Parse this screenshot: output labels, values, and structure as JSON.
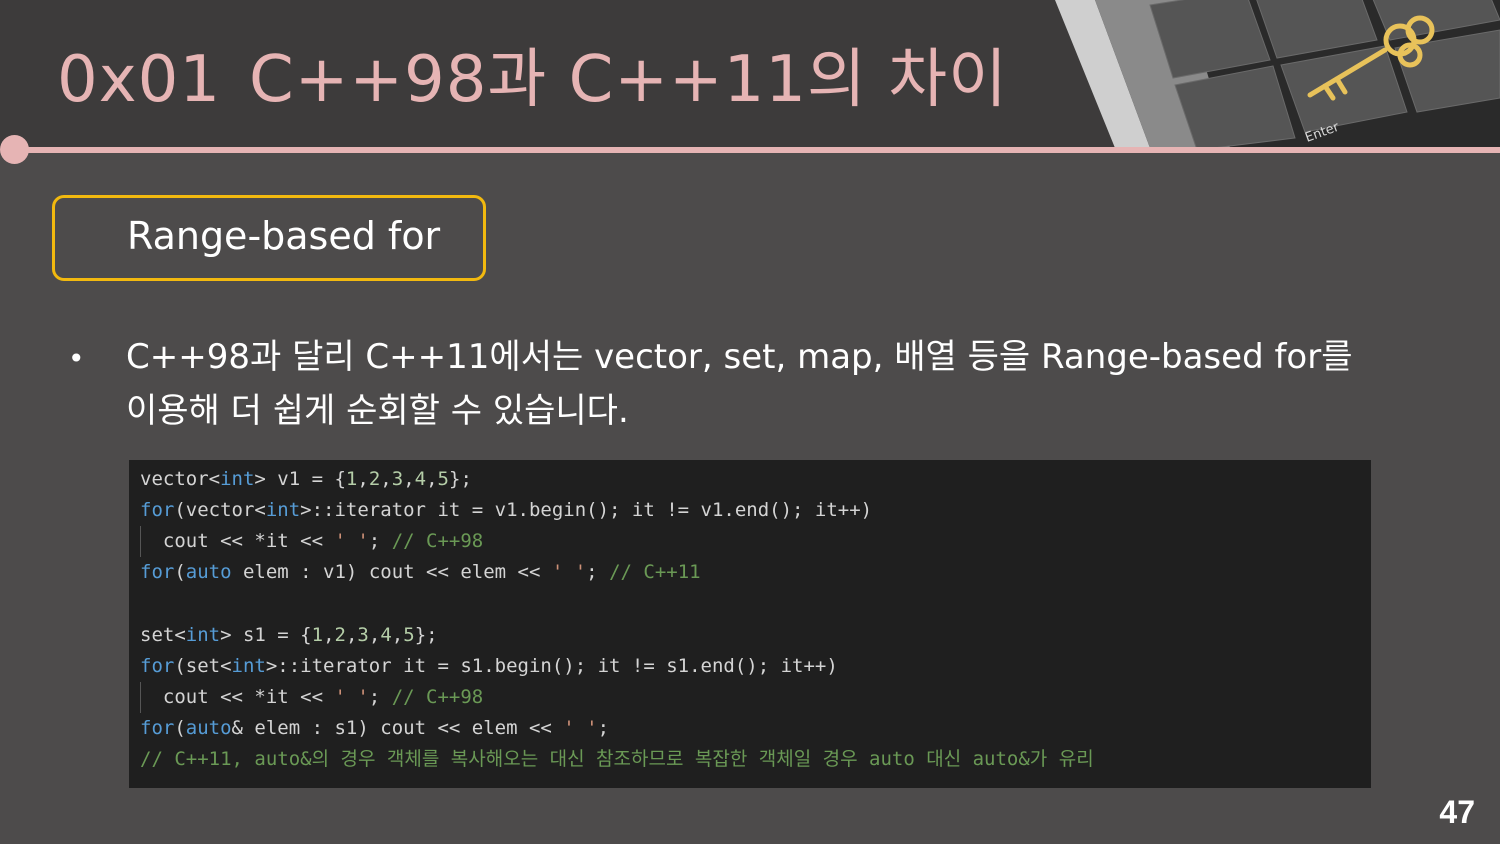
{
  "slide": {
    "title_number": "0x01",
    "title_text": "C++98과 C++11의 차이",
    "section_label": "Range-based for",
    "bullet_line1": "C++98과 달리 C++11에서는 vector, set, map, 배열 등을 Range-based for를",
    "bullet_line2": "이용해 더 쉽게 순회할 수 있습니다.",
    "page_number": "47",
    "header_image_key_label": "Enter",
    "accent_color": "#e6b4b4",
    "box_border_color": "#f2b90f"
  },
  "code": {
    "l1": {
      "a": "vector<",
      "b": "int",
      "c": "> v1 = {",
      "d": "1",
      "e": ",",
      "f": "2",
      "g": ",",
      "h": "3",
      "i": ",",
      "j": "4",
      "k": ",",
      "l": "5",
      "m": "};"
    },
    "l2": {
      "a": "for",
      "b": "(vector<",
      "c": "int",
      "d": ">::iterator it = v1.begin(); it != v1.end(); it++)"
    },
    "l3": {
      "a": "  cout << *it << ",
      "b": "' '",
      "c": "; ",
      "d": "// C++98"
    },
    "l4": {
      "a": "for",
      "b": "(",
      "c": "auto",
      "d": " elem : v1) cout << elem << ",
      "e": "' '",
      "f": "; ",
      "g": "// C++11"
    },
    "l6": {
      "a": "set<",
      "b": "int",
      "c": "> s1 = {",
      "d": "1",
      "e": ",",
      "f": "2",
      "g": ",",
      "h": "3",
      "i": ",",
      "j": "4",
      "k": ",",
      "l": "5",
      "m": "};"
    },
    "l7": {
      "a": "for",
      "b": "(set<",
      "c": "int",
      "d": ">::iterator it = s1.begin(); it != s1.end(); it++)"
    },
    "l8": {
      "a": "  cout << *it << ",
      "b": "' '",
      "c": "; ",
      "d": "// C++98"
    },
    "l9": {
      "a": "for",
      "b": "(",
      "c": "auto",
      "d": "& elem : s1) cout << elem << ",
      "e": "' '",
      "f": ";"
    },
    "l10": {
      "a": "// C++11, auto&의 경우 객체를 복사해오는 대신 참조하므로 복잡한 객체일 경우 auto 대신 auto&가 유리"
    }
  }
}
